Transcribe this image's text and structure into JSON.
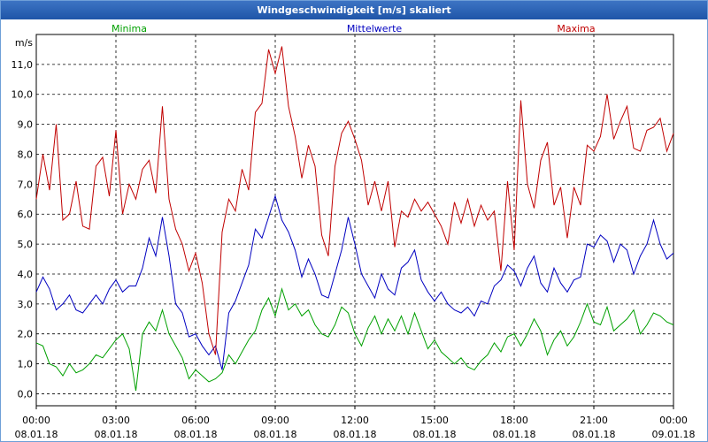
{
  "window": {
    "title": "Windgeschwindigkeit [m/s] skaliert"
  },
  "chart_data": {
    "type": "line",
    "title": "Windgeschwindigkeit [m/s] skaliert",
    "ylabel": "m/s",
    "ylim": [
      -0.4,
      12.0
    ],
    "y_ticks": [
      "0,0",
      "1,0",
      "2,0",
      "3,0",
      "4,0",
      "5,0",
      "6,0",
      "7,0",
      "8,0",
      "9,0",
      "10,0",
      "11,0"
    ],
    "x_ticks": [
      {
        "time": "00:00",
        "date": "08.01.18"
      },
      {
        "time": "03:00",
        "date": "08.01.18"
      },
      {
        "time": "06:00",
        "date": "08.01.18"
      },
      {
        "time": "09:00",
        "date": "08.01.18"
      },
      {
        "time": "12:00",
        "date": "08.01.18"
      },
      {
        "time": "15:00",
        "date": "08.01.18"
      },
      {
        "time": "18:00",
        "date": "08.01.18"
      },
      {
        "time": "21:00",
        "date": "08.01.18"
      },
      {
        "time": "00:00",
        "date": "09.01.18"
      }
    ],
    "grid": true,
    "legend_position": "top",
    "x_hours": [
      0.0,
      0.25,
      0.5,
      0.75,
      1.0,
      1.25,
      1.5,
      1.75,
      2.0,
      2.25,
      2.5,
      2.75,
      3.0,
      3.25,
      3.5,
      3.75,
      4.0,
      4.25,
      4.5,
      4.75,
      5.0,
      5.25,
      5.5,
      5.75,
      6.0,
      6.25,
      6.5,
      6.75,
      7.0,
      7.25,
      7.5,
      7.75,
      8.0,
      8.25,
      8.5,
      8.75,
      9.0,
      9.25,
      9.5,
      9.75,
      10.0,
      10.25,
      10.5,
      10.75,
      11.0,
      11.25,
      11.5,
      11.75,
      12.0,
      12.25,
      12.5,
      12.75,
      13.0,
      13.25,
      13.5,
      13.75,
      14.0,
      14.25,
      14.5,
      14.75,
      15.0,
      15.25,
      15.5,
      15.75,
      16.0,
      16.25,
      16.5,
      16.75,
      17.0,
      17.25,
      17.5,
      17.75,
      18.0,
      18.25,
      18.5,
      18.75,
      19.0,
      19.25,
      19.5,
      19.75,
      20.0,
      20.25,
      20.5,
      20.75,
      21.0,
      21.25,
      21.5,
      21.75,
      22.0,
      22.25,
      22.5,
      22.75,
      23.0,
      23.25,
      23.5,
      23.75,
      24.0
    ],
    "series": [
      {
        "name": "Minima",
        "color": "#00a000",
        "values": [
          1.7,
          1.6,
          1.0,
          0.9,
          0.6,
          1.0,
          0.7,
          0.8,
          1.0,
          1.3,
          1.2,
          1.5,
          1.8,
          2.0,
          1.5,
          0.1,
          2.0,
          2.4,
          2.1,
          2.8,
          2.0,
          1.6,
          1.2,
          0.5,
          0.8,
          0.6,
          0.4,
          0.5,
          0.7,
          1.3,
          1.0,
          1.4,
          1.8,
          2.1,
          2.8,
          3.2,
          2.6,
          3.5,
          2.8,
          3.0,
          2.6,
          2.8,
          2.3,
          2.0,
          1.9,
          2.3,
          2.9,
          2.7,
          2.0,
          1.6,
          2.2,
          2.6,
          2.0,
          2.5,
          2.1,
          2.6,
          2.0,
          2.7,
          2.1,
          1.5,
          1.8,
          1.4,
          1.2,
          1.0,
          1.2,
          0.9,
          0.8,
          1.1,
          1.3,
          1.7,
          1.4,
          1.9,
          2.0,
          1.6,
          2.0,
          2.5,
          2.1,
          1.3,
          1.8,
          2.1,
          1.6,
          1.9,
          2.4,
          3.0,
          2.4,
          2.3,
          2.9,
          2.1,
          2.3,
          2.5,
          2.8,
          2.0,
          2.3,
          2.7,
          2.6,
          2.4,
          2.3
        ]
      },
      {
        "name": "Mittelwerte",
        "color": "#0000c0",
        "values": [
          3.4,
          3.9,
          3.5,
          2.8,
          3.0,
          3.3,
          2.8,
          2.7,
          3.0,
          3.3,
          3.0,
          3.5,
          3.8,
          3.4,
          3.6,
          3.6,
          4.2,
          5.2,
          4.6,
          5.9,
          4.6,
          3.0,
          2.7,
          1.9,
          2.0,
          1.6,
          1.3,
          1.6,
          0.8,
          2.7,
          3.1,
          3.7,
          4.3,
          5.5,
          5.2,
          5.9,
          6.6,
          5.8,
          5.4,
          4.8,
          3.9,
          4.5,
          4.0,
          3.3,
          3.2,
          4.0,
          4.8,
          5.9,
          5.0,
          4.0,
          3.6,
          3.2,
          4.0,
          3.5,
          3.3,
          4.2,
          4.4,
          4.8,
          3.8,
          3.4,
          3.1,
          3.4,
          3.0,
          2.8,
          2.7,
          2.9,
          2.6,
          3.1,
          3.0,
          3.6,
          3.8,
          4.3,
          4.1,
          3.6,
          4.2,
          4.6,
          3.7,
          3.4,
          4.2,
          3.7,
          3.4,
          3.8,
          3.9,
          5.0,
          4.9,
          5.3,
          5.1,
          4.4,
          5.0,
          4.8,
          4.0,
          4.6,
          5.0,
          5.8,
          5.0,
          4.5,
          4.7
        ]
      },
      {
        "name": "Maxima",
        "color": "#c00000",
        "values": [
          6.5,
          8.0,
          6.8,
          9.0,
          5.8,
          6.0,
          7.1,
          5.6,
          5.5,
          7.6,
          7.9,
          6.6,
          8.8,
          6.0,
          7.0,
          6.5,
          7.5,
          7.8,
          6.7,
          9.6,
          6.5,
          5.5,
          5.0,
          4.1,
          4.7,
          3.7,
          2.0,
          1.3,
          5.4,
          6.5,
          6.1,
          7.5,
          6.8,
          9.4,
          9.7,
          11.5,
          10.7,
          11.6,
          9.6,
          8.6,
          7.2,
          8.3,
          7.6,
          5.3,
          4.6,
          7.6,
          8.7,
          9.1,
          8.5,
          7.8,
          6.3,
          7.1,
          6.1,
          7.1,
          4.9,
          6.1,
          5.9,
          6.5,
          6.1,
          6.4,
          6.0,
          5.6,
          5.0,
          6.4,
          5.7,
          6.5,
          5.6,
          6.3,
          5.8,
          6.1,
          4.1,
          7.1,
          4.8,
          9.8,
          7.0,
          6.2,
          7.8,
          8.4,
          6.3,
          6.9,
          5.2,
          6.9,
          6.3,
          8.3,
          8.1,
          8.6,
          10.0,
          8.5,
          9.1,
          9.6,
          8.2,
          8.1,
          8.8,
          8.9,
          9.2,
          8.1,
          8.7
        ]
      }
    ]
  }
}
